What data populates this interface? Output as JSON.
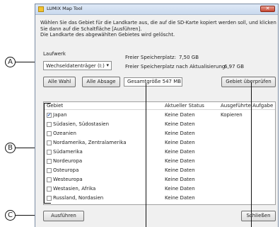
{
  "window": {
    "title": "LUMIX Map Tool",
    "close_glyph": "✕"
  },
  "intro": [
    "Wählen Sie das Gebiet für die Landkarte aus, die auf die SD-Karte kopiert werden soll, und klicken",
    "Sie dann auf die Schaltfläche [Ausführen].",
    "Die Landkarte des abgewählten Gebietes wird gelöscht."
  ],
  "drive": {
    "label": "Laufwerk",
    "selected": "Wechseldatenträger (I:)"
  },
  "storage": {
    "free_label": "Freier Speicherplatz:",
    "free_value": "7,50 GB",
    "after_label": "Freier Speicherplatz nach Aktualisierung:",
    "after_value": "6,97 GB"
  },
  "toolbar": {
    "select_all": "Alle Wahl",
    "deselect_all": "Alle Absage",
    "total_size": "Gesamtgröße  547 MB",
    "check_area": "Gebiet überprüfen"
  },
  "table": {
    "headers": {
      "area": "Gebiet",
      "status": "Aktueller Status",
      "action": "Ausgeführte Aufgabe"
    },
    "rows": [
      {
        "checked": true,
        "area": "Japan",
        "status": "Keine Daten",
        "action": "Kopieren"
      },
      {
        "checked": false,
        "area": "Südasien, Südostasien",
        "status": "Keine Daten",
        "action": ""
      },
      {
        "checked": false,
        "area": "Ozeanien",
        "status": "Keine Daten",
        "action": ""
      },
      {
        "checked": false,
        "area": "Nordamerika, Zentralamerika",
        "status": "Keine Daten",
        "action": ""
      },
      {
        "checked": false,
        "area": "Südamerika",
        "status": "Keine Daten",
        "action": ""
      },
      {
        "checked": false,
        "area": "Nordeuropa",
        "status": "Keine Daten",
        "action": ""
      },
      {
        "checked": false,
        "area": "Osteuropa",
        "status": "Keine Daten",
        "action": ""
      },
      {
        "checked": false,
        "area": "Westeuropa",
        "status": "Keine Daten",
        "action": ""
      },
      {
        "checked": false,
        "area": "Westasien, Afrika",
        "status": "Keine Daten",
        "action": ""
      },
      {
        "checked": false,
        "area": "Russland, Nordasien",
        "status": "Keine Daten",
        "action": ""
      }
    ]
  },
  "buttons": {
    "execute": "Ausführen",
    "close": "Schließen"
  },
  "callouts": {
    "a": "A",
    "b": "B",
    "c": "C"
  }
}
